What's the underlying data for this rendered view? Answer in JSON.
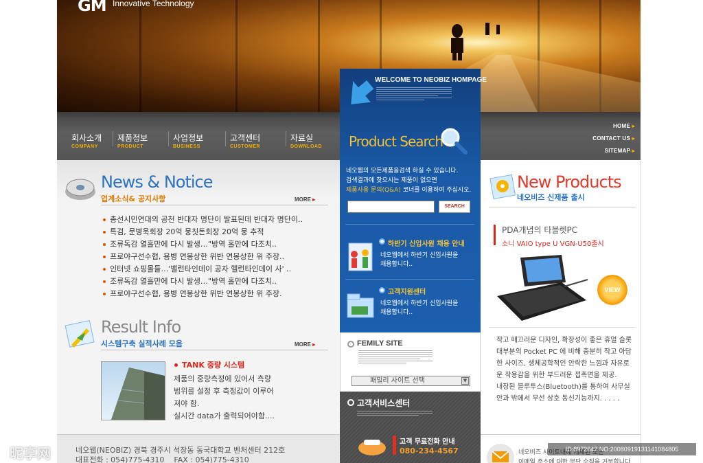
{
  "brand": {
    "logo": "GM",
    "tagline": "Innovative Technology"
  },
  "nav": [
    {
      "ko": "회사소개",
      "en": "COMPANY"
    },
    {
      "ko": "제품정보",
      "en": "PRODUCT"
    },
    {
      "ko": "사업정보",
      "en": "BUSINESS"
    },
    {
      "ko": "고객센터",
      "en": "CUSTOMER"
    },
    {
      "ko": "자료실",
      "en": "DOWNLOAD"
    }
  ],
  "util_links": [
    "HOME",
    "CONTACT US",
    "SITEMAP"
  ],
  "welcome": {
    "title": "WELCOME TO NEOBIZ HOMPAGE"
  },
  "search": {
    "title": "Product Search",
    "desc_line1": "네오웹의 모든제품을검색 하실 수 있습니다.",
    "desc_line2": "검색결과에 찾으시는 제품이 없으면",
    "desc_highlight": "제품사용 문의(Q&A)",
    "desc_line3_rest": " 코너를 이용하여 주십시오.",
    "input_value": "",
    "button": "SEARCH"
  },
  "recruit": {
    "title": "하반기 신입사원 채용 안내",
    "line1": "네오웹에서 하반기 신입사원을",
    "line2": "채용합니다.."
  },
  "support": {
    "title": "고객지원센터",
    "line1": "네오웹에서 하반기 신입사원을",
    "line2": "채용합니다.."
  },
  "family": {
    "title": "FEMILY SITE",
    "select_label": "패밀리 사이트 선택"
  },
  "service": {
    "title": "고객서비스센터",
    "phone_label": "고객 무료전화 안내",
    "phone": "080-234-4567"
  },
  "news": {
    "title": "News & Notice",
    "subtitle": "업계소식& 공지사항",
    "more": "MORE",
    "items": [
      "총선시민연대의 공천 반대자 명단이 발표된데 반대자 명단이..",
      "특검, 문병욱회장 20억 뭉칫돈회장 20억 뭉 추적",
      "조류독감 열흘만에 다시 발생…\"방역 홀만에 다조치..",
      "프로야구선수협, 용병 연봉상한 위반 연봉상한 위 주장..",
      "인터넷 쇼핑몰들…'밸런타인데이 공자 헬런타인데이 사' ..",
      "조류독감 열흘만에 다시 발생…\"방역 홀만에 다조치..",
      "프로야구선수협, 용병 연봉상한 위반 연봉상한 위 주장."
    ]
  },
  "result": {
    "title": "Result Info",
    "subtitle": "시스템구축 실적사례 모음",
    "more": "MORE",
    "item_title": "TANK 중량 시스템",
    "desc": [
      "제품의 중량측정에 있어서 측량",
      "범위를 설정 후 측정값이 이루어",
      "져야 함.",
      "실시간 data가 출력되어야함...."
    ]
  },
  "new_products": {
    "title": "New Products",
    "subtitle": "네오비즈 신제품 출시",
    "item_title": "PDA개념의 타블렛PC",
    "item_model": "소니 VAIO type U VGN-U50출시",
    "view_button": "VIEW",
    "desc": [
      "작고 매끄러운 디자인, 확장성이 좋은 휴얼 슬롯",
      "대부분의 Pocket PC 에 비해 충분히 작고 아담",
      "한 사이즈, 생체공학적인 안락한 느낌과 자유로",
      "운 착용감을 위한 부드러운 접촉면을 제공.",
      "내장된 블루투스(Bluetooth)를 통하여 사무실",
      "안과 밖에서 무선 상호 동신기능까지. . . . ."
    ],
    "newsletter_text": "네오비즈 사이트내에 개제된 모든",
    "newsletter_text2": "이메일 주소에 대한 무단 수집을 거부합니다"
  },
  "footer": {
    "address": "네오웹(NEOBIZ) 경북 경주시 석장동 동국대학교 벤처센터 212호",
    "tel": "대표전화 : 054)775-4310    FAX : 054)775-4310"
  },
  "watermark": {
    "left": "昵享网",
    "right": "ID:8972642 NO:20080919131141084805"
  },
  "colors": {
    "accent_orange": "#e07a00",
    "center_blue": "#1c5fae",
    "nav_gray": "#555555",
    "title_red": "#d9271c"
  }
}
